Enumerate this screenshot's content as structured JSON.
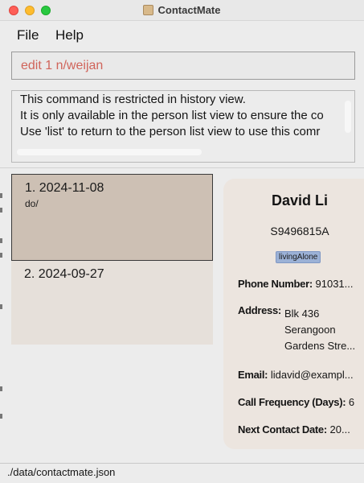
{
  "window": {
    "title": "ContactMate",
    "icon": "address-book-icon"
  },
  "menu": {
    "file": "File",
    "help": "Help"
  },
  "command_box": {
    "value": "edit 1 n/weijan",
    "color": "#d0645a"
  },
  "result_display": {
    "lines": [
      "This command is restricted in history view.",
      "It is only available in the person list view to ensure the co",
      "Use 'list' to return to the person list view to use this comr"
    ]
  },
  "history": {
    "items": [
      {
        "label": "1. 2024-11-08",
        "desc": "do/",
        "selected": true
      },
      {
        "label": "2. 2024-09-27",
        "desc": "",
        "selected": false
      }
    ],
    "selected_color": "#cdc0b4"
  },
  "person": {
    "name": "David Li",
    "nric": "S9496815A",
    "tag": "livingAlone",
    "phone_label": "Phone Number:",
    "phone": "91031...",
    "address_label": "Address:",
    "address_lines": [
      "Blk 436",
      "Serangoon",
      "Gardens Stre..."
    ],
    "email_label": "Email:",
    "email": "lidavid@exampl...",
    "call_freq_label": "Call Frequency (Days):",
    "call_freq": "6",
    "next_contact_label": "Next Contact Date:",
    "next_contact": "20..."
  },
  "status_bar": {
    "path": "./data/contactmate.json"
  }
}
